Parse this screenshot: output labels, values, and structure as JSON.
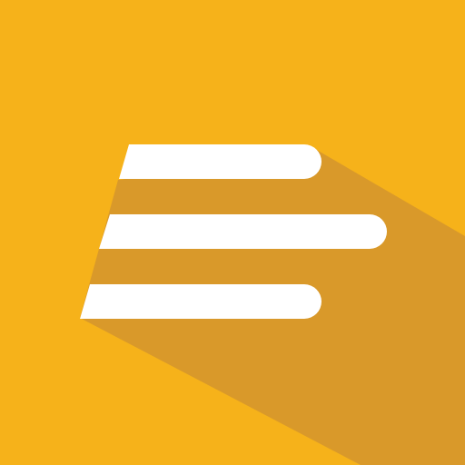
{
  "icon": {
    "name": "align-left-icon",
    "background_color": "#f6b21a",
    "shadow_color": "#d9992a",
    "bar_color": "#ffffff",
    "bar_count": 3
  }
}
